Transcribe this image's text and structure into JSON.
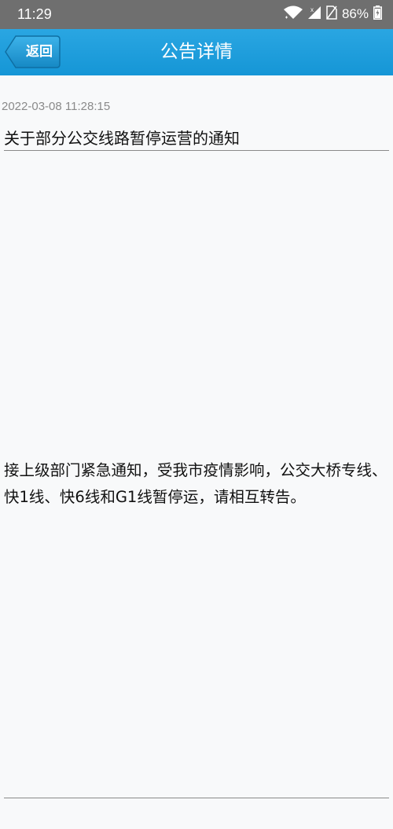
{
  "status_bar": {
    "time": "11:29",
    "battery_percent": "86%",
    "icons": [
      "wifi-icon",
      "signal-icon",
      "sim-absent-icon",
      "battery-icon"
    ]
  },
  "header": {
    "back_label": "返回",
    "title": "公告详情",
    "accent_color": "#1a9ddb"
  },
  "notice": {
    "timestamp": "2022-03-08 11:28:15",
    "title": "关于部分公交线路暂停运营的通知",
    "body": "接上级部门紧急通知，受我市疫情影响，公交大桥专线、快1线、快6线和G1线暂停运，请相互转告。"
  }
}
